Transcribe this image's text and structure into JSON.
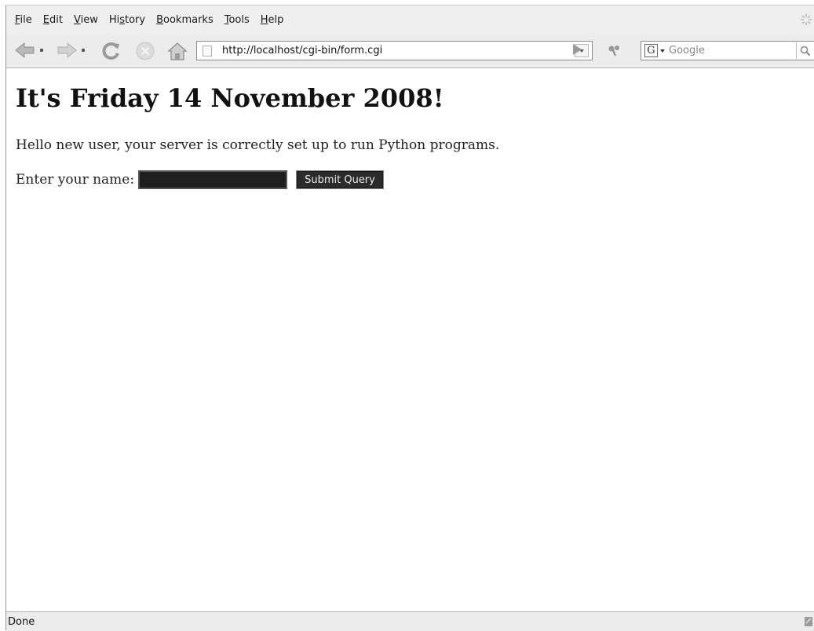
{
  "menu": {
    "items": [
      {
        "accel": "F",
        "rest": "ile"
      },
      {
        "accel": "E",
        "rest": "dit"
      },
      {
        "accel": "V",
        "rest": "iew"
      },
      {
        "pre": "Hi",
        "accel": "s",
        "rest": "tory"
      },
      {
        "accel": "B",
        "rest": "ookmarks"
      },
      {
        "accel": "T",
        "rest": "ools"
      },
      {
        "accel": "H",
        "rest": "elp"
      }
    ]
  },
  "toolbar": {
    "url": "http://localhost/cgi-bin/form.cgi",
    "search_engine_letter": "G",
    "search_placeholder": "Google"
  },
  "page": {
    "heading": "It's Friday 14 November 2008!",
    "intro": "Hello new user, your server is correctly set up to run Python programs.",
    "form_label": "Enter your name:",
    "name_value": "",
    "submit_label": "Submit Query"
  },
  "status": {
    "text": "Done"
  }
}
